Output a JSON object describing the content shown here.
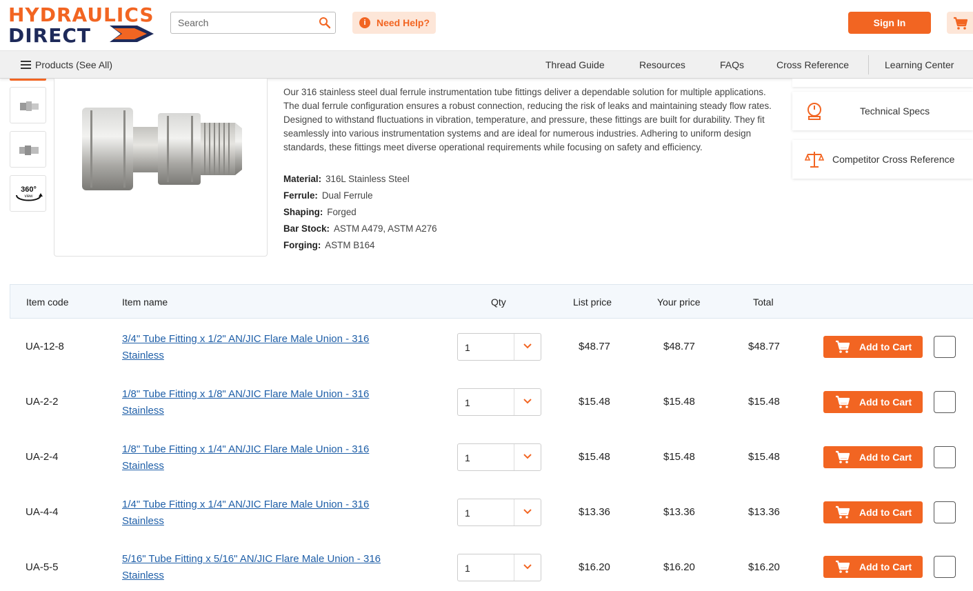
{
  "header": {
    "logo_line1": "HYDRAULICS",
    "logo_line2": "DIRECT",
    "search_placeholder": "Search",
    "help_label": "Need Help?",
    "signin_label": "Sign In",
    "accent_color": "#f26522",
    "brand_navy": "#1e2a5a"
  },
  "nav": {
    "products_label": "Products (See All)",
    "links": [
      "Thread Guide",
      "Resources",
      "FAQs",
      "Cross Reference",
      "Learning Center"
    ]
  },
  "product": {
    "thumbnail_360_label": "360°",
    "thumbnail_360_sub": "view",
    "description": "Our 316 stainless steel dual ferrule instrumentation tube fittings deliver a dependable solution for multiple applications. The dual ferrule configuration ensures a robust connection, reducing the risk of leaks and maintaining steady flow rates. Designed to withstand fluctuations in vibration, temperature, and pressure, these fittings are built for durability. They fit seamlessly into various instrumentation systems and are ideal for numerous industries. Adhering to uniform design standards, these fittings meet diverse operational requirements while focusing on safety and efficiency.",
    "specs": [
      {
        "label": "Material:",
        "value": "316L Stainless Steel"
      },
      {
        "label": "Ferrule:",
        "value": "Dual Ferrule"
      },
      {
        "label": "Shaping:",
        "value": "Forged"
      },
      {
        "label": "Bar Stock:",
        "value": "ASTM A479, ASTM A276"
      },
      {
        "label": "Forging:",
        "value": "ASTM B164"
      }
    ]
  },
  "side_panels": {
    "technical_specs": "Technical Specs",
    "competitor_cross_reference": "Competitor Cross Reference"
  },
  "table": {
    "headers": {
      "item_code": "Item code",
      "item_name": "Item name",
      "qty": "Qty",
      "list_price": "List price",
      "your_price": "Your price",
      "total": "Total"
    },
    "add_label": "Add to Cart",
    "rows": [
      {
        "code": "UA-12-8",
        "name_line1": "3/4\" Tube Fitting x 1/2\" AN/JIC Flare Male Union - 316",
        "name_line2": "Stainless",
        "qty": "1",
        "list": "$48.77",
        "your": "$48.77",
        "total": "$48.77"
      },
      {
        "code": "UA-2-2",
        "name_line1": "1/8\" Tube Fitting x 1/8\" AN/JIC Flare Male Union - 316",
        "name_line2": "Stainless",
        "qty": "1",
        "list": "$15.48",
        "your": "$15.48",
        "total": "$15.48"
      },
      {
        "code": "UA-2-4",
        "name_line1": "1/8\" Tube Fitting x 1/4\" AN/JIC Flare Male Union - 316",
        "name_line2": "Stainless",
        "qty": "1",
        "list": "$15.48",
        "your": "$15.48",
        "total": "$15.48"
      },
      {
        "code": "UA-4-4",
        "name_line1": "1/4\" Tube Fitting x 1/4\" AN/JIC Flare Male Union - 316",
        "name_line2": "Stainless",
        "qty": "1",
        "list": "$13.36",
        "your": "$13.36",
        "total": "$13.36"
      },
      {
        "code": "UA-5-5",
        "name_line1": "5/16\" Tube Fitting x 5/16\" AN/JIC Flare Male Union - 316",
        "name_line2": "Stainless",
        "qty": "1",
        "list": "$16.20",
        "your": "$16.20",
        "total": "$16.20"
      }
    ]
  }
}
